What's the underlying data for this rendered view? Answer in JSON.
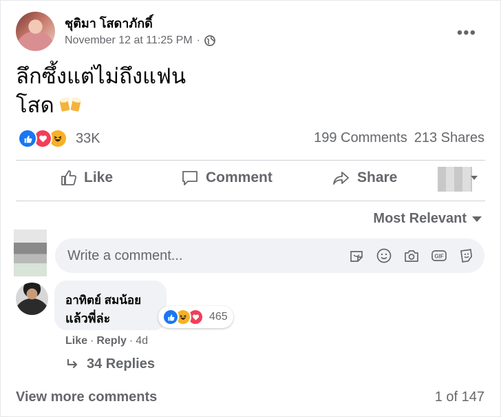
{
  "post": {
    "author": "ชุติมา โสดาภักดิ์",
    "timestamp": "November 12 at 11:25 PM",
    "separator": "·",
    "privacy_icon": "globe-icon",
    "text_line1": "ลึกซึ้งแต่ไม่ถึงแฟน",
    "text_line2": "โสด",
    "emoji": "beer-mugs-icon"
  },
  "reactions": {
    "count": "33K",
    "types": [
      "like",
      "love",
      "haha"
    ]
  },
  "stats": {
    "comments": "199 Comments",
    "shares": "213 Shares"
  },
  "actions": {
    "like": "Like",
    "comment": "Comment",
    "share": "Share"
  },
  "sort": {
    "label": "Most Relevant"
  },
  "comment_box": {
    "placeholder": "Write a comment...",
    "icons": [
      "sticker-icon",
      "emoji-icon",
      "camera-icon",
      "gif-icon",
      "avatar-sticker-icon"
    ]
  },
  "comment": {
    "author": "อาทิตย์ สมน้อย",
    "text": "แล้วพี่ล่ะ",
    "reaction_count": "465",
    "like": "Like",
    "reply": "Reply",
    "dot": "·",
    "time": "4d",
    "replies": "34 Replies"
  },
  "footer": {
    "view_more": "View more comments",
    "pager": "1 of 147"
  },
  "colors": {
    "accent": "#1877f2",
    "love": "#f33e58",
    "haha": "#f7b125",
    "muted_text": "#65676b",
    "input_bg": "#f0f2f5"
  }
}
